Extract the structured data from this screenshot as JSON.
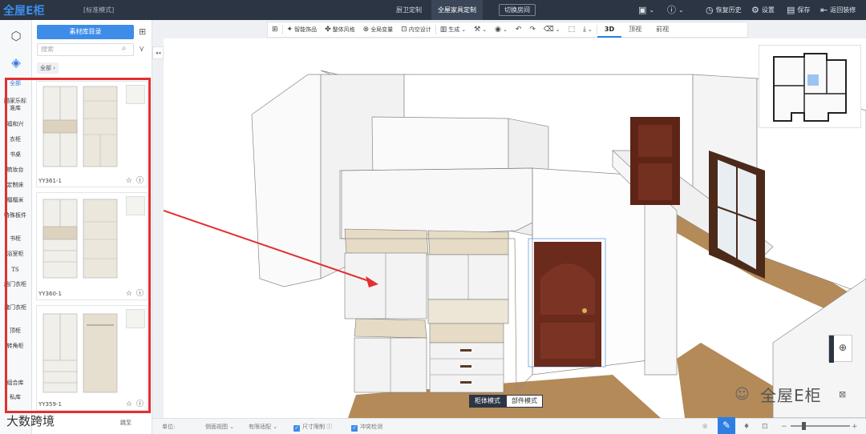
{
  "topbar": {
    "logo": "全屋E柜",
    "mode_label": "[标准模式]",
    "tabs": [
      {
        "label": "厨卫定制",
        "active": false
      },
      {
        "label": "全屋家具定制",
        "active": true
      }
    ],
    "switch_room": "切换房间",
    "right_items": [
      {
        "icon": "save-icon",
        "label": ""
      },
      {
        "icon": "help-icon",
        "label": ""
      },
      {
        "icon": "history-icon",
        "label": "恢复历史"
      },
      {
        "icon": "gear-icon",
        "label": "设置"
      },
      {
        "icon": "save-disk-icon",
        "label": "保存"
      },
      {
        "icon": "exit-icon",
        "label": "返回装修"
      }
    ]
  },
  "panel": {
    "library_button": "素材库目录",
    "search_placeholder": "搜索",
    "filter_chip": "全部",
    "categories": [
      {
        "label": "全部",
        "active": true
      },
      {
        "label": "酷家乐标准库",
        "active": false
      },
      {
        "label": "福和兴",
        "active": false
      },
      {
        "label": "衣柜",
        "active": false
      },
      {
        "label": "书桌",
        "active": false
      },
      {
        "label": "梳妆台",
        "active": false
      },
      {
        "label": "定制床",
        "active": false
      },
      {
        "label": "榻榻米",
        "active": false
      },
      {
        "label": "特殊板件",
        "active": false
      },
      {
        "label": "书柜",
        "active": false
      },
      {
        "label": "浴室柜",
        "active": false
      },
      {
        "label": "TS",
        "active": false
      },
      {
        "label": "趟门衣柜",
        "active": false
      },
      {
        "label": "掩门衣柜",
        "active": false
      },
      {
        "label": "顶柜",
        "active": false
      },
      {
        "label": "转角柜",
        "active": false
      },
      {
        "label": "组合库",
        "active": false
      },
      {
        "label": "私库",
        "active": false
      }
    ],
    "products": [
      {
        "name": "YY361-1"
      },
      {
        "name": "YY360-1"
      },
      {
        "name": "YY359-1"
      }
    ],
    "page_jump": "跳至"
  },
  "toolbar": {
    "items": [
      {
        "icon": "grid-icon",
        "label": ""
      },
      {
        "icon": "decor-icon",
        "label": "智能饰品"
      },
      {
        "icon": "style-icon",
        "label": "整体风格"
      },
      {
        "icon": "replace-icon",
        "label": "全局变量"
      },
      {
        "icon": "space-icon",
        "label": "内空设计"
      },
      {
        "icon": "generate-icon",
        "label": "生成"
      },
      {
        "icon": "tool-icon",
        "label": ""
      },
      {
        "icon": "eye-icon",
        "label": ""
      },
      {
        "icon": "undo-icon",
        "label": ""
      },
      {
        "icon": "redo-icon",
        "label": ""
      },
      {
        "icon": "eraser-icon",
        "label": ""
      },
      {
        "icon": "frame-icon",
        "label": ""
      },
      {
        "icon": "download-icon",
        "label": ""
      }
    ],
    "views": [
      {
        "label": "3D",
        "active": true
      },
      {
        "label": "顶视",
        "active": false
      },
      {
        "label": "前视",
        "active": false
      }
    ]
  },
  "viewport": {
    "mode_switch": [
      {
        "label": "柜体模式",
        "active": true
      },
      {
        "label": "部件模式",
        "active": false
      }
    ],
    "watermark": "全屋E柜"
  },
  "bottombar": {
    "unit": "单位:",
    "side_view": "侧面视图",
    "auto_fit": "有限适配",
    "size_limit": "尺寸限制",
    "collision": "冲突检测",
    "bottom_wm": "大数跨境"
  },
  "colors": {
    "accent": "#3d8de8",
    "topbar": "#2b3544",
    "highlight": "#e23030",
    "floor": "#b48a58",
    "door": "#6a2a1c"
  }
}
